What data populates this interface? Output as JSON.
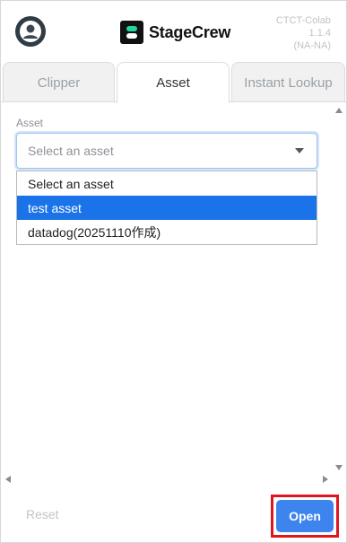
{
  "header": {
    "brand": "StageCrew",
    "version_lines": [
      "CTCT-Colab",
      "1.1.4",
      "(NA-NA)"
    ]
  },
  "tabs": [
    {
      "label": "Clipper",
      "active": false
    },
    {
      "label": "Asset",
      "active": true
    },
    {
      "label": "Instant Lookup",
      "active": false
    }
  ],
  "asset": {
    "label": "Asset",
    "placeholder": "Select an asset",
    "options": [
      "Select an asset",
      "test asset",
      "datadog(20251110作成)"
    ],
    "highlighted_index": 1
  },
  "footer": {
    "reset_label": "Reset",
    "open_label": "Open"
  },
  "colors": {
    "accent": "#3e84ee",
    "highlight": "#1a73e8",
    "annotation": "#e0161e"
  }
}
